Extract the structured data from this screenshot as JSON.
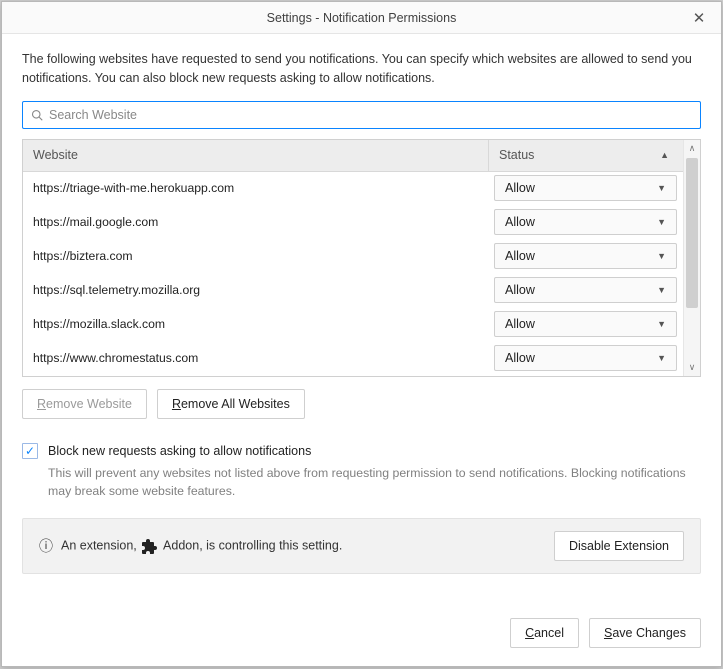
{
  "title": "Settings - Notification Permissions",
  "description": "The following websites have requested to send you notifications. You can specify which websites are allowed to send you notifications. You can also block new requests asking to allow notifications.",
  "search": {
    "placeholder": "Search Website",
    "value": ""
  },
  "columns": {
    "website": "Website",
    "status": "Status"
  },
  "rows": [
    {
      "website": "https://triage-with-me.herokuapp.com",
      "status": "Allow"
    },
    {
      "website": "https://mail.google.com",
      "status": "Allow"
    },
    {
      "website": "https://biztera.com",
      "status": "Allow"
    },
    {
      "website": "https://sql.telemetry.mozilla.org",
      "status": "Allow"
    },
    {
      "website": "https://mozilla.slack.com",
      "status": "Allow"
    },
    {
      "website": "https://www.chromestatus.com",
      "status": "Allow"
    }
  ],
  "buttons": {
    "remove_one": "Remove Website",
    "remove_all": "Remove All Websites",
    "cancel": "Cancel",
    "save": "Save Changes",
    "disable_ext": "Disable Extension"
  },
  "checkbox": {
    "label": "Block new requests asking to allow notifications",
    "desc": "This will prevent any websites not listed above from requesting permission to send notifications. Blocking notifications may break some website features.",
    "checked": true
  },
  "extension": {
    "pre": "An extension,",
    "name": "Addon",
    "post": ", is controlling this setting."
  }
}
